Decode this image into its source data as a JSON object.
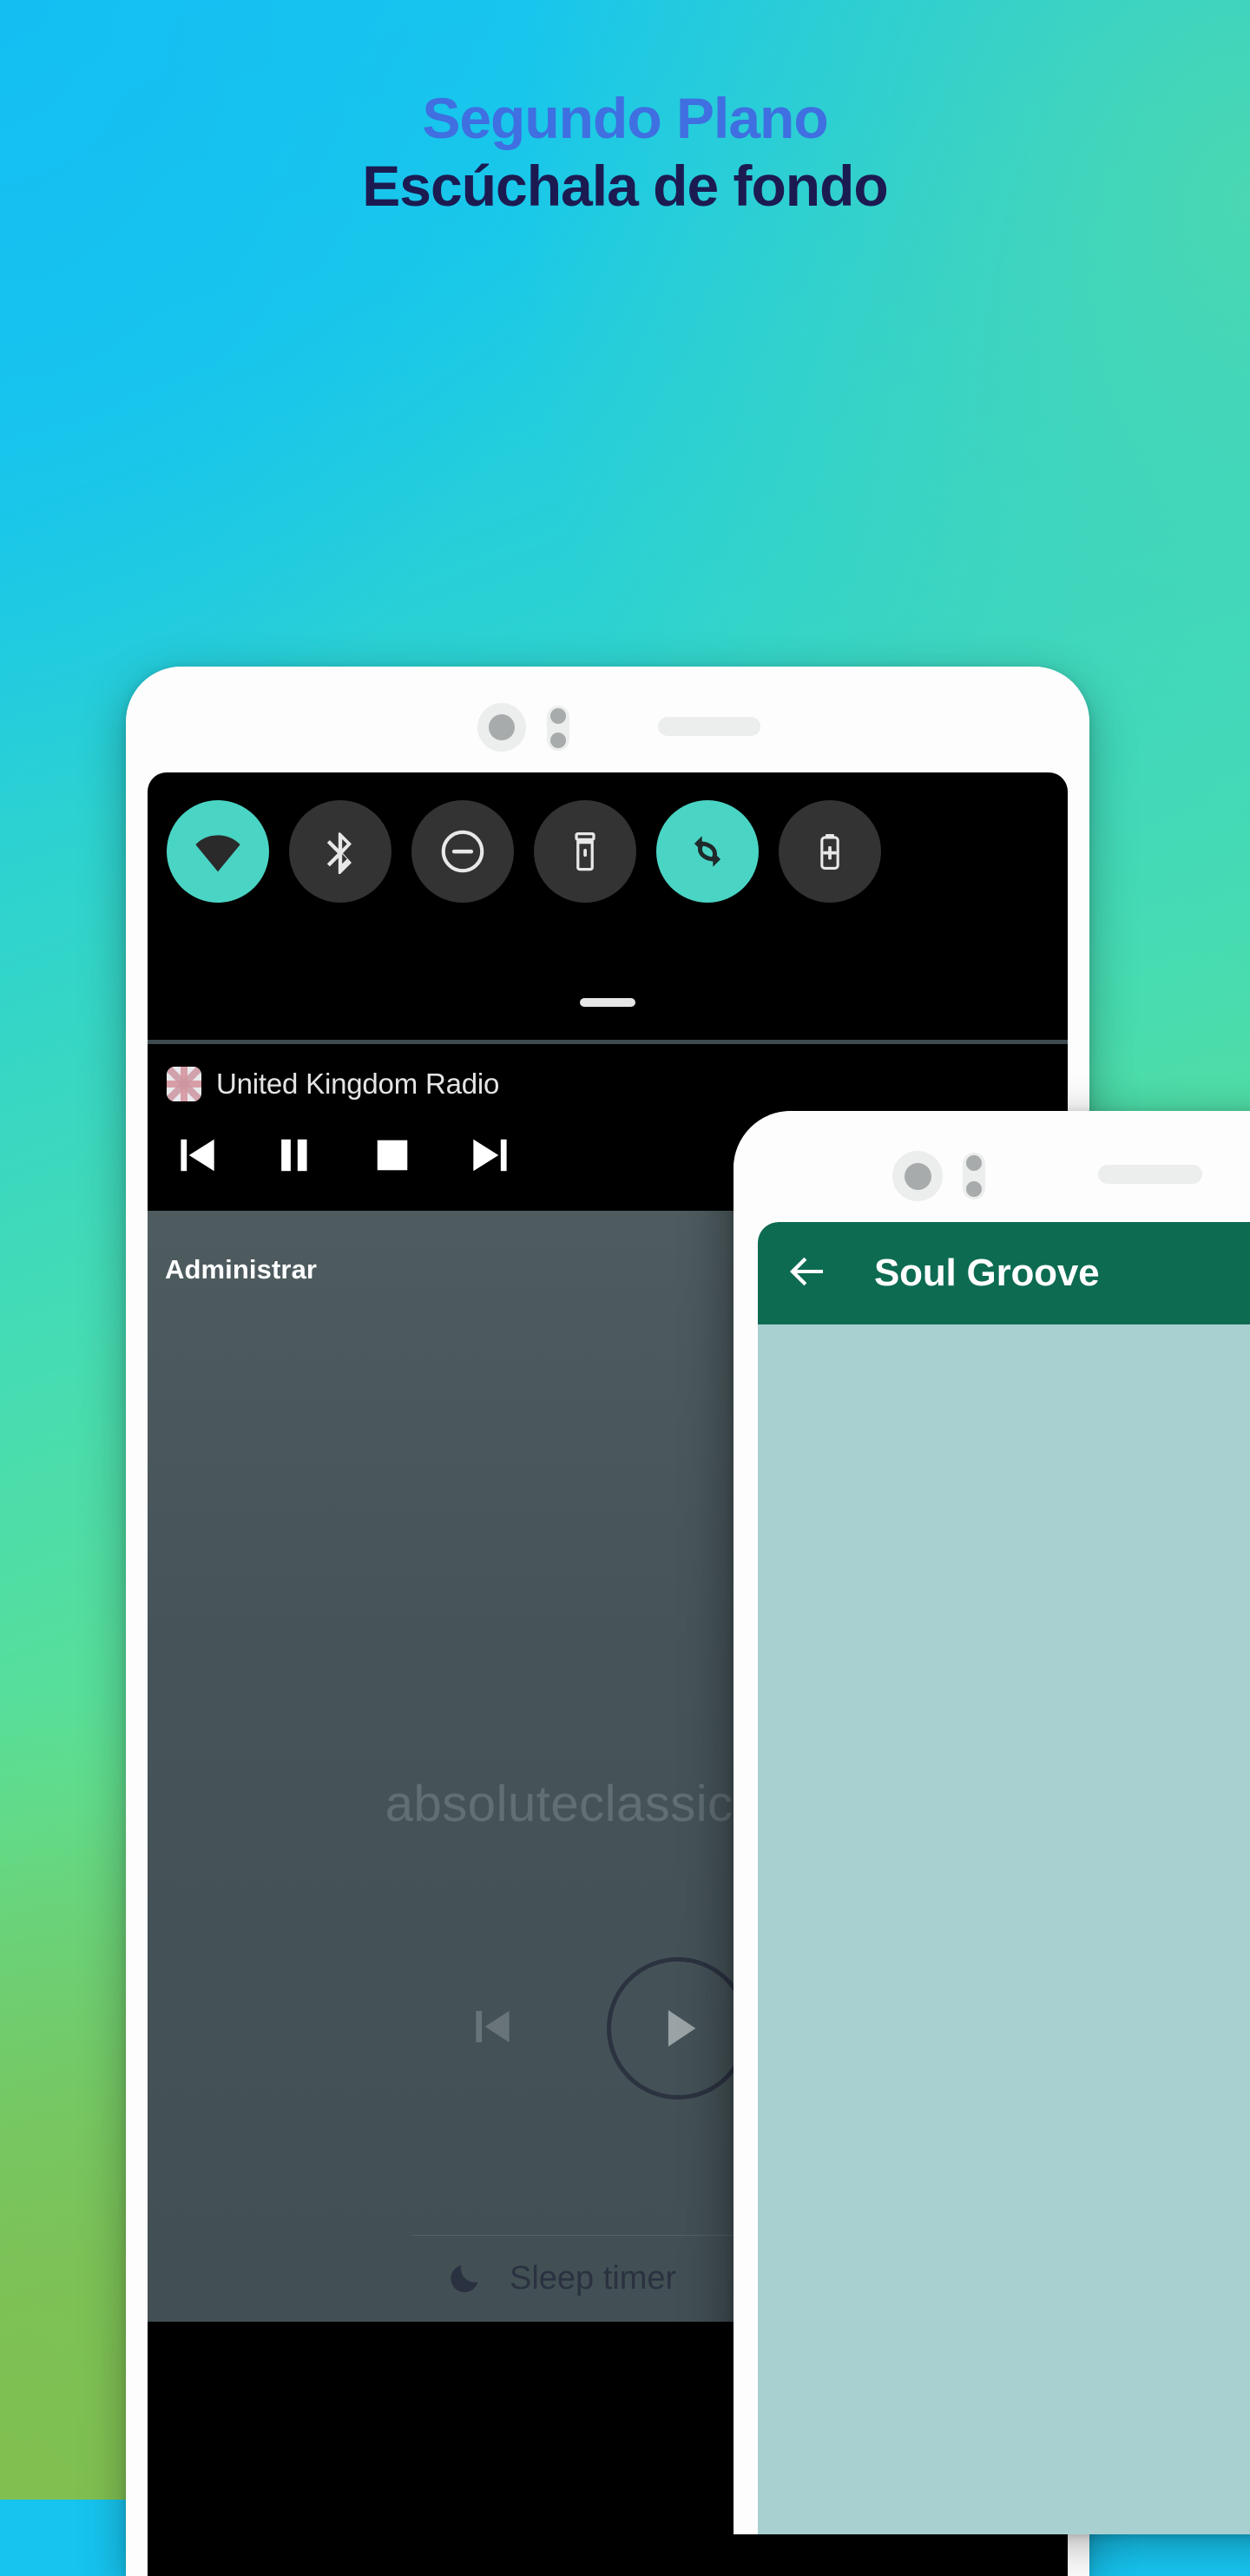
{
  "headline": {
    "line1": "Segundo Plano",
    "line2": "Escúchala de fondo",
    "line1_color": "#3f6fe0",
    "line2_color": "#1b1b52"
  },
  "background": {
    "top_left_color": "#17c3f0",
    "top_right_color": "#4cd8b0",
    "bottom_left_color": "#84bf4c"
  },
  "phone1": {
    "quick_settings": {
      "tiles": [
        {
          "name": "wifi",
          "label": "Wi-Fi",
          "state": "on"
        },
        {
          "name": "bluetooth",
          "label": "Bluetooth",
          "state": "off"
        },
        {
          "name": "do-not-disturb",
          "label": "No molestar",
          "state": "off"
        },
        {
          "name": "flashlight",
          "label": "Linterna",
          "state": "off"
        },
        {
          "name": "auto-rotate",
          "label": "Rotación automática",
          "state": "on"
        },
        {
          "name": "battery-saver",
          "label": "Ahorro de batería",
          "state": "off"
        }
      ],
      "active_color": "#4ad4c4",
      "inactive_color": "#333333"
    },
    "media_notification": {
      "station_title": "United Kingdom Radio",
      "station_icon": "uk-flag-icon",
      "controls": [
        {
          "name": "previous",
          "label": "Anterior"
        },
        {
          "name": "pause",
          "label": "Pausa"
        },
        {
          "name": "stop",
          "label": "Detener"
        },
        {
          "name": "next",
          "label": "Siguiente"
        }
      ]
    },
    "app_panel": {
      "section_label": "Administrar",
      "background_color": "#46545a",
      "watermark_icon": "music-note-icon",
      "now_playing_ghost": "absoluteclassicrock",
      "ghost_controls": [
        {
          "name": "previous",
          "label": "Anterior"
        },
        {
          "name": "play",
          "label": "Reproducir"
        }
      ],
      "sleep_timer_label": "Sleep timer",
      "sleep_timer_icon": "moon-icon"
    }
  },
  "phone2": {
    "appbar": {
      "back_label": "Atrás",
      "back_icon": "arrow-left-icon",
      "title": "Soul Groove",
      "background_color": "#0d6b52"
    },
    "body_color": "#a9d0d1"
  }
}
